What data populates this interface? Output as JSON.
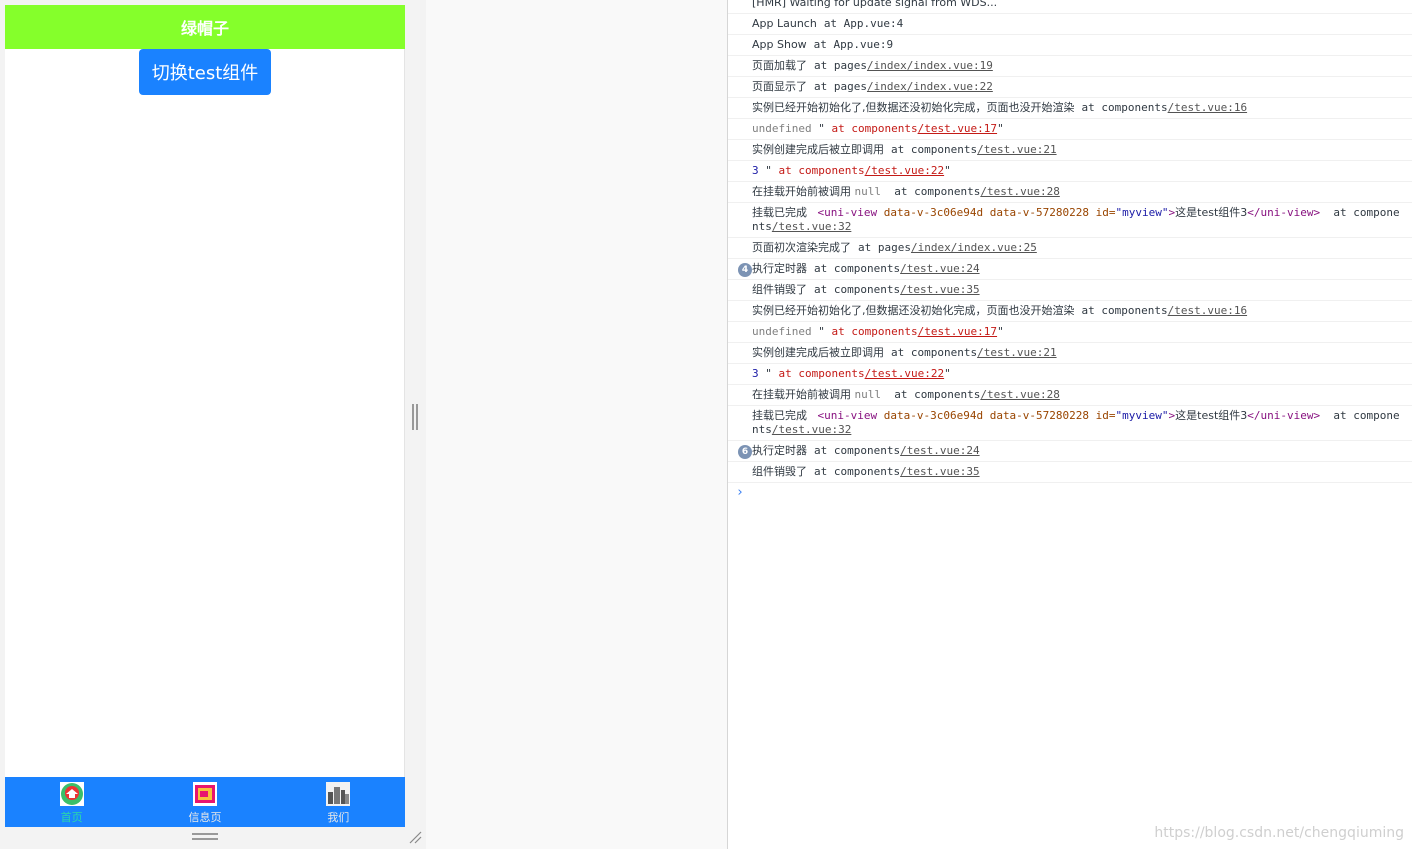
{
  "simulator": {
    "navbar_title": "绿帽子",
    "switch_button": "切换test组件",
    "tabs": [
      {
        "label": "首页",
        "icon": "home-icon",
        "color": "#2bd9a8"
      },
      {
        "label": "信息页",
        "icon": "info-icon",
        "color": "#e8e8e8"
      },
      {
        "label": "我们",
        "icon": "city-icon",
        "color": "#e8e8e8"
      }
    ],
    "colors": {
      "navbar": "#85ff2b",
      "tabbar": "#1a82ff",
      "button": "#1a82ff"
    }
  },
  "console": {
    "rows": [
      {
        "text": "[HMR] Waiting for update signal from WDS..."
      },
      {
        "text": "App Launch  ",
        "at": "at App.vue:4"
      },
      {
        "text": "App Show  ",
        "at": "at App.vue:9"
      },
      {
        "text": "页面加载了  ",
        "at": "at pages",
        "link": "/index/index.vue:19"
      },
      {
        "text": "页面显示了  ",
        "at": "at pages",
        "link": "/index/index.vue:22"
      },
      {
        "text": "实例已经开始初始化了,但数据还没初始化完成，页面也没开始渲染  ",
        "at": "at components",
        "link": "/test.vue:16"
      },
      {
        "pre": "undefined",
        "mid": " \" ",
        "red": "at components",
        "link": "/test.vue:17",
        "post": "\""
      },
      {
        "text": "实例创建完成后被立即调用  ",
        "at": "at components",
        "link": "/test.vue:21"
      },
      {
        "pre": "3",
        "mid": " \" ",
        "red": "at components",
        "link": "/test.vue:22",
        "post": "\""
      },
      {
        "text": "在挂载开始前被调用 ",
        "gray": "null",
        "at": "  at components",
        "link": "/test.vue:28"
      },
      {
        "text": "挂载已完成   ",
        "tag_open": "<uni-view",
        "attr1": " data-v-3c06e94d data-v-57280228 id=",
        "attr_val": "\"myview\"",
        "tag_close": ">",
        "inner": "这是test组件3",
        "tag_end": "</uni-view>",
        "at": "  at components",
        "link": "/test.vue:32"
      },
      {
        "text": "页面初次渲染完成了  ",
        "at": "at pages",
        "link": "/index/index.vue:25"
      },
      {
        "badge": "4",
        "text": "执行定时器  ",
        "at": "at components",
        "link": "/test.vue:24"
      },
      {
        "text": "组件销毁了  ",
        "at": "at components",
        "link": "/test.vue:35"
      },
      {
        "text": "实例已经开始初始化了,但数据还没初始化完成，页面也没开始渲染  ",
        "at": "at components",
        "link": "/test.vue:16"
      },
      {
        "pre": "undefined",
        "mid": " \" ",
        "red": "at components",
        "link": "/test.vue:17",
        "post": "\""
      },
      {
        "text": "实例创建完成后被立即调用  ",
        "at": "at components",
        "link": "/test.vue:21"
      },
      {
        "pre": "3",
        "mid": " \" ",
        "red": "at components",
        "link": "/test.vue:22",
        "post": "\""
      },
      {
        "text": "在挂载开始前被调用 ",
        "gray": "null",
        "at": "  at components",
        "link": "/test.vue:28"
      },
      {
        "text": "挂载已完成   ",
        "tag_open": "<uni-view",
        "attr1": " data-v-3c06e94d data-v-57280228 id=",
        "attr_val": "\"myview\"",
        "tag_close": ">",
        "inner": "这是test组件3",
        "tag_end": "</uni-view>",
        "at": "  at components",
        "link": "/test.vue:32"
      },
      {
        "badge": "6",
        "text": "执行定时器  ",
        "at": "at components",
        "link": "/test.vue:24"
      },
      {
        "text": "组件销毁了  ",
        "at": "at components",
        "link": "/test.vue:35"
      }
    ],
    "prompt": "›"
  },
  "watermark": "https://blog.csdn.net/chengqiuming"
}
